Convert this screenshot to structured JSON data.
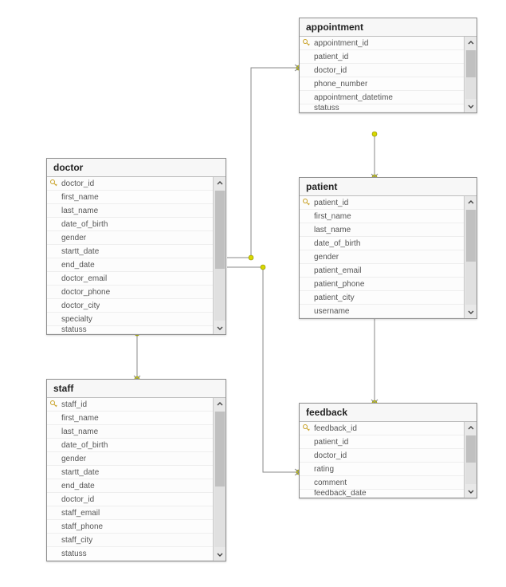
{
  "entities": {
    "appointment": {
      "title": "appointment",
      "fields": [
        {
          "name": "appointment_id",
          "pk": true
        },
        {
          "name": "patient_id",
          "pk": false
        },
        {
          "name": "doctor_id",
          "pk": false
        },
        {
          "name": "phone_number",
          "pk": false
        },
        {
          "name": "appointment_datetime",
          "pk": false
        },
        {
          "name": "statuss",
          "pk": false
        }
      ]
    },
    "doctor": {
      "title": "doctor",
      "fields": [
        {
          "name": "doctor_id",
          "pk": true
        },
        {
          "name": "first_name",
          "pk": false
        },
        {
          "name": "last_name",
          "pk": false
        },
        {
          "name": "date_of_birth",
          "pk": false
        },
        {
          "name": "gender",
          "pk": false
        },
        {
          "name": "startt_date",
          "pk": false
        },
        {
          "name": "end_date",
          "pk": false
        },
        {
          "name": "doctor_email",
          "pk": false
        },
        {
          "name": "doctor_phone",
          "pk": false
        },
        {
          "name": "doctor_city",
          "pk": false
        },
        {
          "name": "specialty",
          "pk": false
        },
        {
          "name": "statuss",
          "pk": false
        }
      ]
    },
    "patient": {
      "title": "patient",
      "fields": [
        {
          "name": "patient_id",
          "pk": true
        },
        {
          "name": "first_name",
          "pk": false
        },
        {
          "name": "last_name",
          "pk": false
        },
        {
          "name": "date_of_birth",
          "pk": false
        },
        {
          "name": "gender",
          "pk": false
        },
        {
          "name": "patient_email",
          "pk": false
        },
        {
          "name": "patient_phone",
          "pk": false
        },
        {
          "name": "patient_city",
          "pk": false
        },
        {
          "name": "username",
          "pk": false
        }
      ]
    },
    "staff": {
      "title": "staff",
      "fields": [
        {
          "name": "staff_id",
          "pk": true
        },
        {
          "name": "first_name",
          "pk": false
        },
        {
          "name": "last_name",
          "pk": false
        },
        {
          "name": "date_of_birth",
          "pk": false
        },
        {
          "name": "gender",
          "pk": false
        },
        {
          "name": "startt_date",
          "pk": false
        },
        {
          "name": "end_date",
          "pk": false
        },
        {
          "name": "doctor_id",
          "pk": false
        },
        {
          "name": "staff_email",
          "pk": false
        },
        {
          "name": "staff_phone",
          "pk": false
        },
        {
          "name": "staff_city",
          "pk": false
        },
        {
          "name": "statuss",
          "pk": false
        }
      ]
    },
    "feedback": {
      "title": "feedback",
      "fields": [
        {
          "name": "feedback_id",
          "pk": true
        },
        {
          "name": "patient_id",
          "pk": false
        },
        {
          "name": "doctor_id",
          "pk": false
        },
        {
          "name": "rating",
          "pk": false
        },
        {
          "name": "comment",
          "pk": false
        },
        {
          "name": "feedback_date",
          "pk": false
        }
      ]
    }
  },
  "relationships": [
    {
      "from": "doctor",
      "to": "appointment",
      "via": "doctor_id"
    },
    {
      "from": "patient",
      "to": "appointment",
      "via": "patient_id"
    },
    {
      "from": "doctor",
      "to": "staff",
      "via": "doctor_id"
    },
    {
      "from": "patient",
      "to": "feedback",
      "via": "patient_id"
    },
    {
      "from": "doctor",
      "to": "feedback",
      "via": "doctor_id"
    }
  ]
}
